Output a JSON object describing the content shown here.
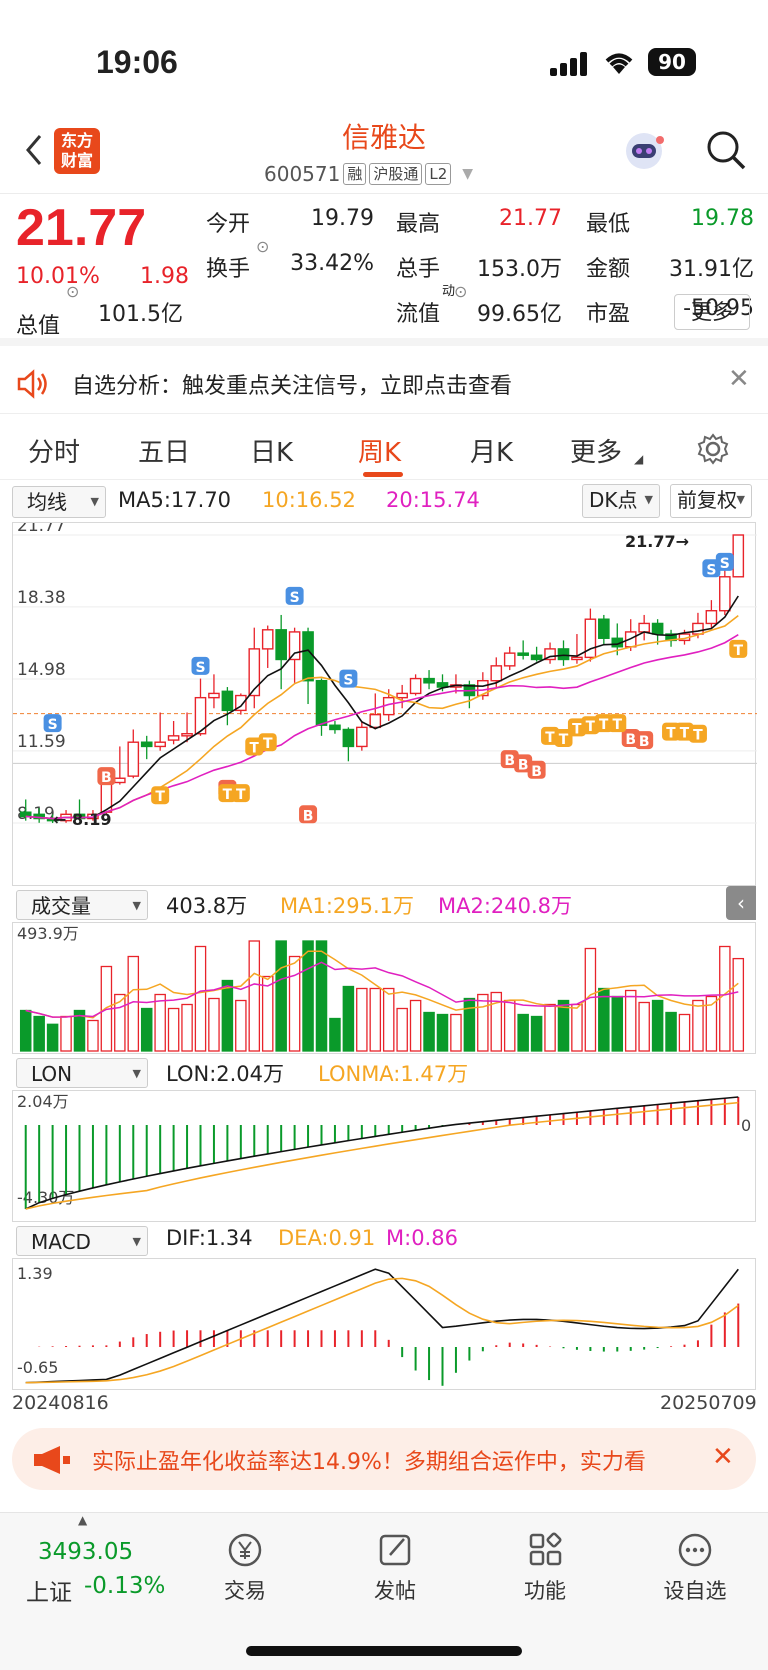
{
  "status": {
    "time": "19:06",
    "battery": "90"
  },
  "nav": {
    "logo": "东方财富",
    "stock_name": "信雅达",
    "code": "600571",
    "tags": [
      "融",
      "沪股通",
      "L2"
    ]
  },
  "quote": {
    "price": "21.77",
    "pct": "10.01%",
    "chg": "1.98",
    "rows": [
      [
        {
          "l": "今开",
          "v": "19.79",
          "c": "black"
        },
        {
          "l": "最高",
          "v": "21.77",
          "c": "red"
        },
        {
          "l": "最低",
          "v": "19.78",
          "c": "green"
        }
      ],
      [
        {
          "l": "换手",
          "v": "33.42%",
          "c": "black"
        },
        {
          "l": "总手",
          "v": "153.0万",
          "c": "black"
        },
        {
          "l": "金额",
          "v": "31.91亿",
          "c": "black"
        }
      ],
      [
        {
          "l": "总值",
          "v": "101.5亿",
          "c": "black"
        },
        {
          "l": "流值",
          "v": "99.65亿",
          "c": "black"
        },
        {
          "l": "市盈",
          "v": "-50.95",
          "c": "black"
        }
      ]
    ],
    "dyn_label": "动",
    "more": "更多"
  },
  "notice": {
    "text": "自选分析：触发重点关注信号，立即点击查看"
  },
  "tabs": [
    "分时",
    "五日",
    "日K",
    "周K",
    "月K",
    "更多"
  ],
  "active_tab": "周K",
  "kline": {
    "indicator": "均线",
    "ma5": "MA5:17.70",
    "ma10": "10:16.52",
    "ma20": "20:15.74",
    "dk": "DK点",
    "fq": "前复权",
    "y_labels": [
      "21.77",
      "18.38",
      "14.98",
      "11.59",
      "8.19"
    ],
    "high_marker": "21.77",
    "low_marker": "8.19",
    "colors": {
      "ma5": "#111111",
      "ma10": "#f5a623",
      "ma20": "#e020c0"
    }
  },
  "volume": {
    "indicator": "成交量",
    "value": "403.8万",
    "ma1": "MA1:295.1万",
    "ma2": "MA2:240.8万",
    "max": "493.9万"
  },
  "lon": {
    "indicator": "LON",
    "value": "LON:2.04万",
    "ma": "LONMA:1.47万",
    "max": "2.04万",
    "min": "-4.30万",
    "zero": "0"
  },
  "macd": {
    "indicator": "MACD",
    "dif": "DIF:1.34",
    "dea": "DEA:0.91",
    "m": "M:0.86",
    "max": "1.39",
    "min": "-0.65",
    "date_start": "20240816",
    "date_end": "20250709"
  },
  "banner": {
    "text": "实际止盈年化收益率达14.9%！多期组合运作中，实力看"
  },
  "bottom": {
    "index_value": "3493.05",
    "index_name": "上证",
    "index_pct": "-0.13%",
    "items": [
      "交易",
      "发帖",
      "功能",
      "设自选"
    ]
  },
  "chart_data": {
    "type": "candlestick",
    "period": "weekly",
    "candles": [
      [
        8.7,
        8.5,
        9.3,
        8.3
      ],
      [
        8.6,
        8.4,
        8.9,
        8.2
      ],
      [
        8.4,
        8.3,
        8.6,
        8.19
      ],
      [
        8.3,
        8.6,
        8.8,
        8.2
      ],
      [
        8.6,
        8.4,
        9.3,
        8.3
      ],
      [
        8.4,
        8.6,
        8.8,
        8.3
      ],
      [
        8.7,
        10.2,
        10.5,
        8.6
      ],
      [
        10.1,
        10.3,
        11.8,
        10.0
      ],
      [
        10.4,
        12.0,
        12.6,
        10.3
      ],
      [
        12.0,
        11.8,
        12.3,
        11.2
      ],
      [
        11.8,
        12.0,
        13.4,
        11.6
      ],
      [
        12.1,
        12.3,
        13.0,
        11.9
      ],
      [
        12.3,
        12.4,
        13.4,
        12.0
      ],
      [
        12.4,
        14.1,
        15.0,
        12.3
      ],
      [
        14.1,
        14.3,
        15.2,
        13.6
      ],
      [
        14.4,
        13.5,
        14.6,
        12.8
      ],
      [
        13.5,
        14.2,
        14.3,
        13.3
      ],
      [
        14.2,
        16.4,
        17.4,
        13.6
      ],
      [
        16.4,
        17.3,
        17.5,
        15.5
      ],
      [
        17.3,
        15.9,
        18.0,
        14.5
      ],
      [
        15.9,
        17.2,
        17.4,
        14.8
      ],
      [
        17.2,
        14.9,
        17.4,
        13.8
      ],
      [
        14.9,
        12.8,
        15.0,
        12.3
      ],
      [
        12.8,
        12.6,
        13.0,
        12.4
      ],
      [
        12.6,
        11.8,
        12.7,
        11.1
      ],
      [
        11.8,
        12.7,
        13.0,
        11.6
      ],
      [
        12.7,
        13.3,
        14.3,
        12.6
      ],
      [
        13.3,
        14.1,
        14.5,
        13.0
      ],
      [
        14.1,
        14.3,
        14.7,
        13.6
      ],
      [
        14.3,
        15.0,
        15.2,
        14.2
      ],
      [
        15.0,
        14.8,
        15.4,
        14.5
      ],
      [
        14.8,
        14.6,
        15.2,
        14.4
      ],
      [
        14.6,
        14.7,
        15.2,
        14.3
      ],
      [
        14.7,
        14.2,
        14.9,
        13.6
      ],
      [
        14.2,
        14.9,
        15.3,
        14.0
      ],
      [
        14.9,
        15.6,
        16.0,
        14.6
      ],
      [
        15.6,
        16.2,
        16.5,
        15.4
      ],
      [
        16.2,
        16.1,
        16.8,
        15.9
      ],
      [
        16.1,
        15.9,
        16.5,
        15.8
      ],
      [
        15.9,
        16.4,
        16.7,
        15.7
      ],
      [
        16.4,
        15.9,
        16.8,
        15.6
      ],
      [
        15.9,
        16.0,
        17.1,
        15.7
      ],
      [
        16.0,
        17.8,
        18.3,
        15.8
      ],
      [
        17.8,
        16.9,
        18.0,
        16.6
      ],
      [
        16.9,
        16.5,
        17.6,
        16.1
      ],
      [
        16.5,
        17.2,
        17.8,
        16.3
      ],
      [
        17.2,
        17.6,
        18.0,
        16.8
      ],
      [
        17.6,
        17.1,
        17.8,
        16.6
      ],
      [
        17.1,
        16.8,
        17.3,
        16.5
      ],
      [
        16.8,
        17.1,
        17.3,
        16.6
      ],
      [
        17.1,
        17.6,
        18.1,
        16.9
      ],
      [
        17.6,
        18.2,
        18.7,
        17.4
      ],
      [
        18.2,
        19.8,
        20.8,
        18.0
      ],
      [
        19.8,
        21.77,
        21.77,
        19.78
      ]
    ],
    "volumes": [
      {
        "v": 60,
        "up": true
      }
    ],
    "x_range": [
      "20240816",
      "20250709"
    ],
    "y_range": [
      8.19,
      21.77
    ]
  }
}
